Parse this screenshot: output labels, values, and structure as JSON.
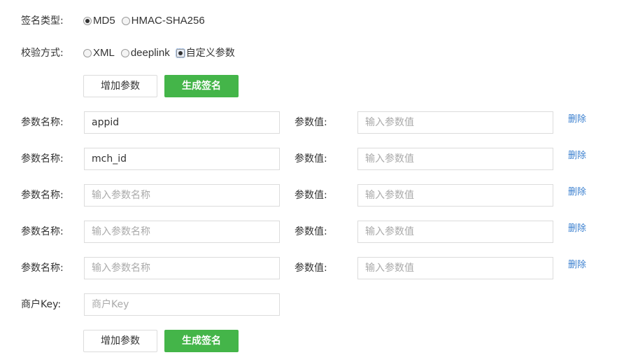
{
  "sign_type": {
    "label": "签名类型:",
    "options": [
      {
        "label": "MD5",
        "checked": true
      },
      {
        "label": "HMAC-SHA256",
        "checked": false
      }
    ]
  },
  "verify_method": {
    "label": "校验方式:",
    "options": [
      {
        "label": "XML",
        "checked": false
      },
      {
        "label": "deeplink",
        "checked": false
      },
      {
        "label": "自定义参数",
        "checked": true
      }
    ]
  },
  "buttons": {
    "add_param": "增加参数",
    "generate_sign": "生成签名"
  },
  "params": {
    "name_label": "参数名称:",
    "value_label": "参数值:",
    "delete_label": "删除",
    "name_placeholder": "输入参数名称",
    "value_placeholder": "输入参数值",
    "rows": [
      {
        "name": "appid",
        "value": ""
      },
      {
        "name": "mch_id",
        "value": ""
      },
      {
        "name": "",
        "value": ""
      },
      {
        "name": "",
        "value": ""
      },
      {
        "name": "",
        "value": ""
      }
    ]
  },
  "merchant_key": {
    "label": "商户Key:",
    "placeholder": "商户Key",
    "value": ""
  }
}
